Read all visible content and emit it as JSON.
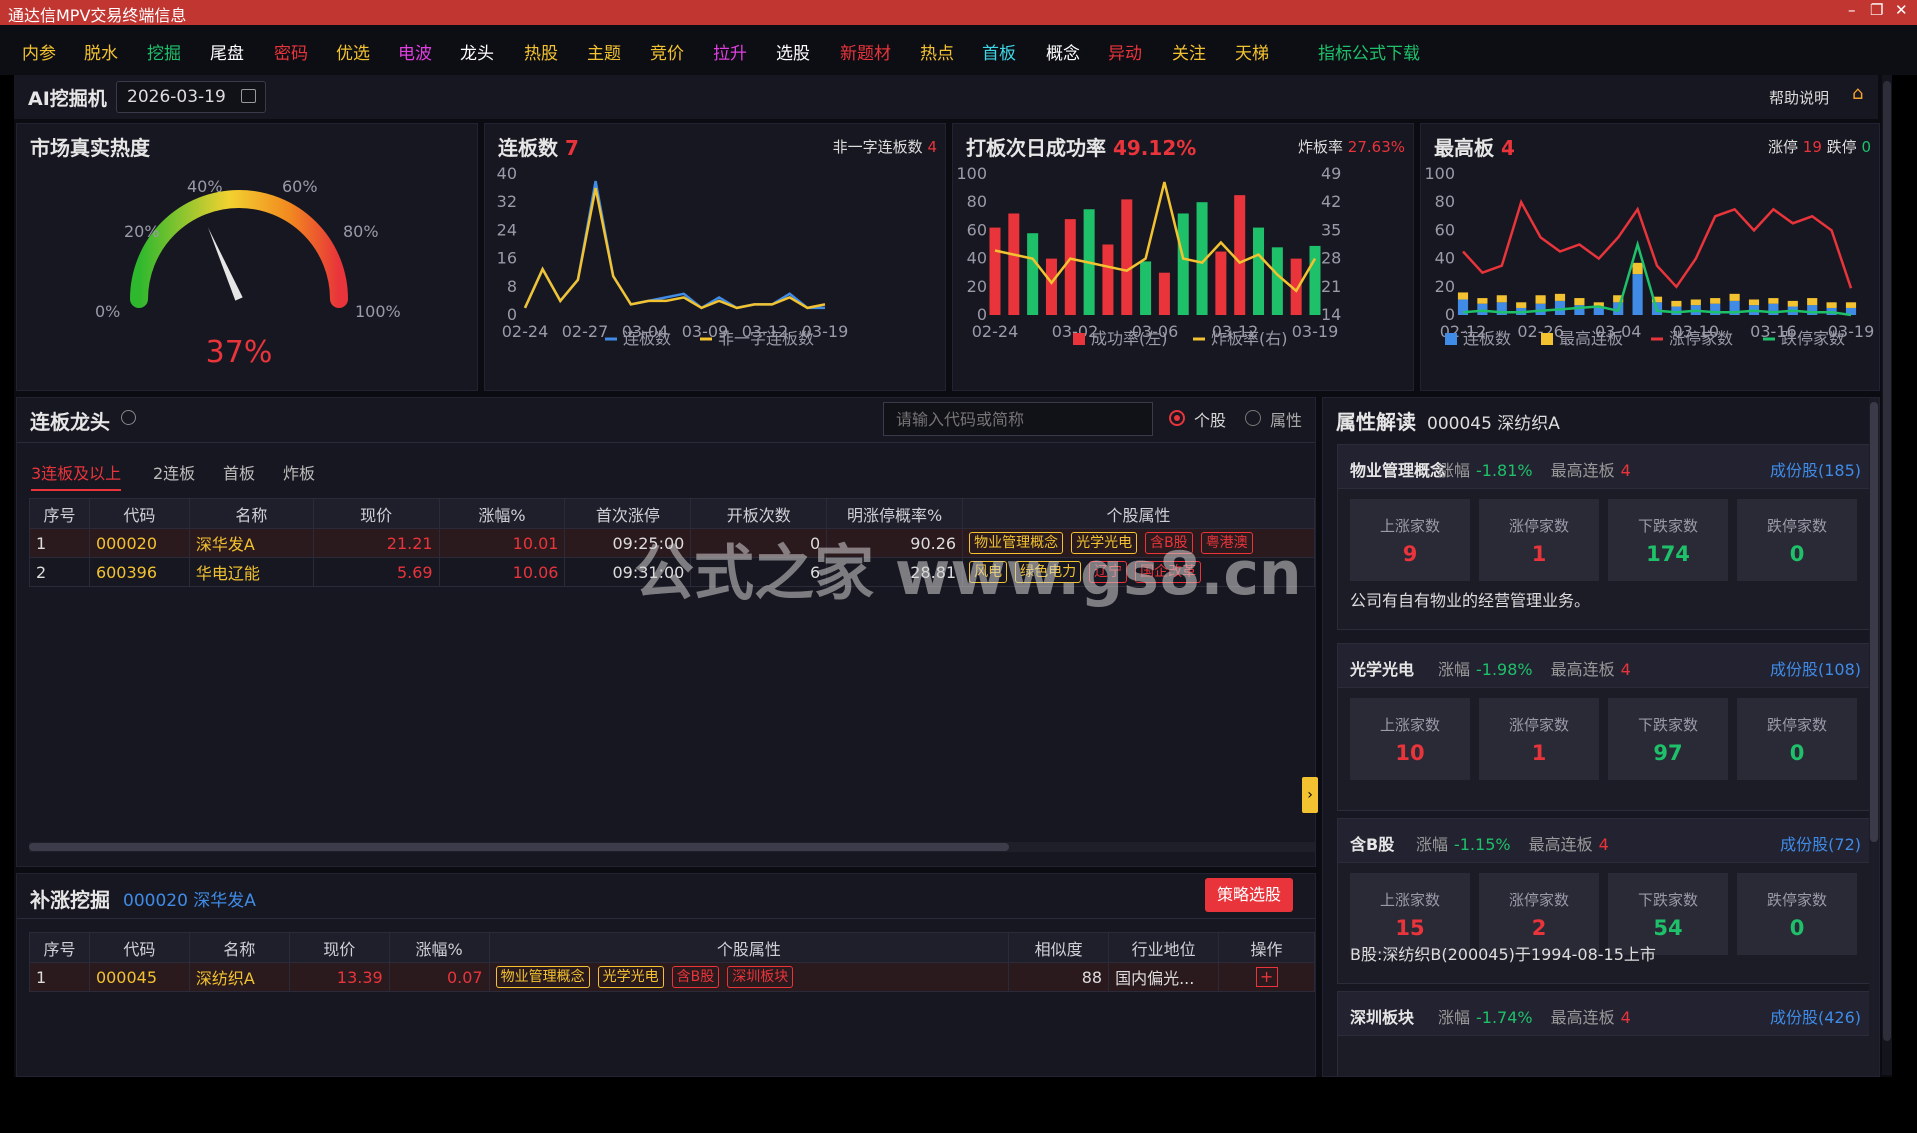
{
  "window": {
    "title": "通达信MPV交易终端信息",
    "controls": [
      "–",
      "❐",
      "✕"
    ]
  },
  "menu": [
    {
      "label": "内参",
      "color": "#f2c230"
    },
    {
      "label": "脱水",
      "color": "#f2c230"
    },
    {
      "label": "挖掘",
      "color": "#1ec16a"
    },
    {
      "label": "尾盘",
      "color": "#ffffff"
    },
    {
      "label": "密码",
      "color": "#e8343a"
    },
    {
      "label": "优选",
      "color": "#f2c230"
    },
    {
      "label": "电波",
      "color": "#e040e0"
    },
    {
      "label": "龙头",
      "color": "#ffffff"
    },
    {
      "label": "热股",
      "color": "#f2c230"
    },
    {
      "label": "主题",
      "color": "#f2c230"
    },
    {
      "label": "竞价",
      "color": "#f2c230"
    },
    {
      "label": "拉升",
      "color": "#e040e0"
    },
    {
      "label": "选股",
      "color": "#ffffff"
    },
    {
      "label": "新题材",
      "color": "#e8343a"
    },
    {
      "label": "热点",
      "color": "#f2c230"
    },
    {
      "label": "首板",
      "color": "#3fd6e6"
    },
    {
      "label": "概念",
      "color": "#ffffff"
    },
    {
      "label": "异动",
      "color": "#e8343a"
    },
    {
      "label": "关注",
      "color": "#f2c230"
    },
    {
      "label": "天梯",
      "color": "#f2c230"
    },
    {
      "label": "指标公式下载",
      "color": "#1ec16a"
    }
  ],
  "header": {
    "title": "AI挖掘机",
    "date": "2026-03-19",
    "help": "帮助说明"
  },
  "heat": {
    "title": "市场真实热度",
    "value_pct": 37,
    "value_label": "37%",
    "ticks": [
      "0%",
      "20%",
      "40%",
      "60%",
      "80%",
      "100%"
    ]
  },
  "lianban": {
    "title": "连板数",
    "count": "7",
    "sub_label": "非一字连板数",
    "sub_count": "4",
    "x_labels": [
      "02-24",
      "02-27",
      "03-04",
      "03-09",
      "03-12",
      "03-19"
    ],
    "y_labels": [
      "40",
      "32",
      "24",
      "16",
      "8",
      "0"
    ],
    "legend": [
      "连板数",
      "非一字连板数"
    ]
  },
  "success": {
    "title": "打板次日成功率",
    "rate": "49.12%",
    "zha_label": "炸板率",
    "zha_value": "27.63%",
    "x_labels": [
      "02-24",
      "03-02",
      "03-06",
      "03-12",
      "03-19"
    ],
    "y_left": [
      "100",
      "80",
      "60",
      "40",
      "20",
      "0"
    ],
    "y_right": [
      "49",
      "42",
      "35",
      "28",
      "21",
      "14"
    ],
    "legend": [
      "成功率(左)",
      "炸板率(右)"
    ]
  },
  "highest": {
    "title": "最高板",
    "count": "4",
    "zt_label": "涨停",
    "zt": "19",
    "dt_label": "跌停",
    "dt": "0",
    "x_labels": [
      "02-12",
      "02-26",
      "03-04",
      "03-10",
      "03-16",
      "03-19"
    ],
    "y_labels": [
      "100",
      "80",
      "60",
      "40",
      "20",
      "0"
    ],
    "legend": [
      "连板数",
      "最高连板",
      "涨停家数",
      "跌停家数"
    ]
  },
  "leader": {
    "title": "连板龙头",
    "search_placeholder": "请输入代码或简称",
    "radio1": "个股",
    "radio2": "属性",
    "tabs": [
      "3连板及以上",
      "2连板",
      "首板",
      "炸板"
    ],
    "columns": [
      "序号",
      "代码",
      "名称",
      "现价",
      "涨幅%",
      "首次涨停",
      "开板次数",
      "明涨停概率%",
      "个股属性"
    ],
    "rows": [
      {
        "idx": "1",
        "code": "000020",
        "name": "深华发A",
        "price": "21.21",
        "chg": "10.01",
        "first": "09:25:00",
        "open": "0",
        "prob": "90.26",
        "tags": [
          [
            "物业管理概念",
            "y"
          ],
          [
            "光学光电",
            "y"
          ],
          [
            "含B股",
            "r"
          ],
          [
            "粤港澳",
            "r"
          ]
        ]
      },
      {
        "idx": "2",
        "code": "600396",
        "name": "华电辽能",
        "price": "5.69",
        "chg": "10.06",
        "first": "09:31:00",
        "open": "6",
        "prob": "28.81",
        "tags": [
          [
            "风电",
            "y"
          ],
          [
            "绿色电力",
            "y"
          ],
          [
            "辽宁",
            "r"
          ],
          [
            "国企改革",
            "r"
          ]
        ]
      }
    ]
  },
  "buzhang": {
    "title": "补涨挖掘",
    "target": "000020 深华发A",
    "button": "策略选股",
    "columns": [
      "序号",
      "代码",
      "名称",
      "现价",
      "涨幅%",
      "个股属性",
      "相似度",
      "行业地位",
      "操作"
    ],
    "rows": [
      {
        "idx": "1",
        "code": "000045",
        "name": "深纺织A",
        "price": "13.39",
        "chg": "0.07",
        "tags": [
          [
            "物业管理概念",
            "y"
          ],
          [
            "光学光电",
            "y"
          ],
          [
            "含B股",
            "r"
          ],
          [
            "深圳板块",
            "r"
          ]
        ],
        "sim": "88",
        "rank": "国内偏光...",
        "op": "+"
      }
    ]
  },
  "attr": {
    "title": "属性解读",
    "stock": "000045 深纺织A",
    "sections": [
      {
        "name": "物业管理概念",
        "chg_label": "涨幅",
        "chg": "-1.81%",
        "max_label": "最高连板",
        "max": "4",
        "members": "成份股(185)",
        "up": "9",
        "zt": "1",
        "down": "174",
        "dt": "0",
        "desc": "公司有自有物业的经营管理业务。"
      },
      {
        "name": "光学光电",
        "chg_label": "涨幅",
        "chg": "-1.98%",
        "max_label": "最高连板",
        "max": "4",
        "members": "成份股(108)",
        "up": "10",
        "zt": "1",
        "down": "97",
        "dt": "0",
        "desc": ""
      },
      {
        "name": "含B股",
        "chg_label": "涨幅",
        "chg": "-1.15%",
        "max_label": "最高连板",
        "max": "4",
        "members": "成份股(72)",
        "up": "15",
        "zt": "2",
        "down": "54",
        "dt": "0",
        "desc": "B股:深纺织B(200045)于1994-08-15上市"
      },
      {
        "name": "深圳板块",
        "chg_label": "涨幅",
        "chg": "-1.74%",
        "max_label": "最高连板",
        "max": "4",
        "members": "成份股(426)",
        "up": "",
        "zt": "",
        "down": "",
        "dt": "",
        "desc": ""
      }
    ],
    "stat_labels": [
      "上涨家数",
      "涨停家数",
      "下跌家数",
      "跌停家数"
    ]
  },
  "watermark": {
    "big": "公式之家 www.gs8.cn",
    "small": "公式之家 www.gs8.cn"
  },
  "chart_data": [
    {
      "type": "gauge",
      "title": "市场真实热度",
      "value": 37,
      "range": [
        0,
        100
      ]
    },
    {
      "type": "line",
      "title": "连板数",
      "x": [
        "02-24",
        "02-25",
        "02-26",
        "02-27",
        "03-02",
        "03-03",
        "03-04",
        "03-05",
        "03-06",
        "03-09",
        "03-10",
        "03-11",
        "03-12",
        "03-13",
        "03-16",
        "03-17",
        "03-18",
        "03-19"
      ],
      "series": [
        {
          "name": "连板数",
          "values": [
            2,
            13,
            4,
            10,
            38,
            11,
            3,
            4,
            5,
            6,
            2,
            5,
            2,
            3,
            3,
            6,
            2,
            2
          ]
        },
        {
          "name": "非一字连板数",
          "values": [
            2,
            13,
            4,
            10,
            36,
            11,
            3,
            4,
            4,
            5,
            2,
            4,
            2,
            3,
            3,
            5,
            2,
            3
          ]
        }
      ],
      "ylim": [
        0,
        40
      ]
    },
    {
      "type": "bar",
      "title": "打板次日成功率",
      "x": [
        "02-24",
        "02-25",
        "02-26",
        "02-27",
        "03-02",
        "03-03",
        "03-04",
        "03-05",
        "03-06",
        "03-09",
        "03-10",
        "03-11",
        "03-12",
        "03-13",
        "03-16",
        "03-17",
        "03-18",
        "03-19"
      ],
      "series": [
        {
          "name": "成功率(左)",
          "values": [
            62,
            72,
            58,
            40,
            68,
            75,
            50,
            82,
            38,
            30,
            72,
            80,
            45,
            85,
            62,
            48,
            40,
            49
          ]
        },
        {
          "name": "炸板率(右)",
          "values": [
            30,
            29,
            28,
            22,
            28,
            27,
            26,
            25,
            28,
            47,
            28,
            27,
            32,
            27,
            29,
            24,
            20,
            28
          ]
        }
      ],
      "ylim": [
        0,
        100
      ],
      "y2lim": [
        14,
        49
      ]
    },
    {
      "type": "bar",
      "title": "最高板",
      "x": [
        "02-12",
        "02-13",
        "02-16",
        "02-17",
        "02-18",
        "02-26",
        "02-27",
        "03-02",
        "03-03",
        "03-04",
        "03-05",
        "03-06",
        "03-09",
        "03-10",
        "03-11",
        "03-12",
        "03-13",
        "03-16",
        "03-17",
        "03-18",
        "03-19"
      ],
      "series": [
        {
          "name": "连板数",
          "values": [
            11,
            8,
            9,
            5,
            8,
            10,
            7,
            5,
            9,
            29,
            9,
            6,
            7,
            8,
            10,
            7,
            8,
            6,
            7,
            5,
            5
          ]
        },
        {
          "name": "最高连板",
          "values": [
            5,
            4,
            5,
            4,
            6,
            5,
            5,
            4,
            5,
            8,
            4,
            4,
            4,
            4,
            5,
            4,
            4,
            4,
            5,
            4,
            4
          ]
        },
        {
          "name": "涨停家数",
          "values": [
            45,
            30,
            35,
            80,
            55,
            45,
            50,
            40,
            55,
            75,
            35,
            20,
            40,
            70,
            75,
            60,
            75,
            65,
            70,
            60,
            19
          ]
        },
        {
          "name": "跌停家数",
          "values": [
            2,
            3,
            2,
            2,
            3,
            4,
            5,
            6,
            3,
            50,
            3,
            2,
            3,
            2,
            2,
            3,
            2,
            3,
            2,
            2,
            0
          ]
        }
      ],
      "ylim": [
        0,
        100
      ]
    }
  ]
}
